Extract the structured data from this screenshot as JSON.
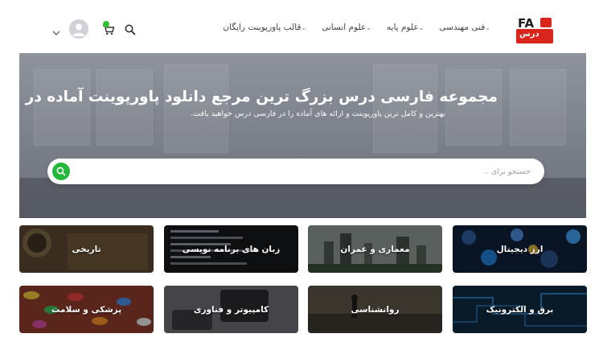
{
  "logo": {
    "latin": "FA",
    "persian": "درس"
  },
  "nav": [
    {
      "label": "فنی مهندسی"
    },
    {
      "label": "علوم پایه"
    },
    {
      "label": "علوم انسانی"
    },
    {
      "label": "قالب پاورپوینت رایگان"
    }
  ],
  "hero": {
    "title": "مجموعه فارسی درس بزرگ ترین مرجع دانلود پاورپوینت آماده در ایران",
    "subtitle": "بهترین و کامل ترین پاورپوینت و ارائه های آماده را در فارسی درس خواهید یافت.",
    "search_placeholder": "جستجو برای .."
  },
  "categories": [
    {
      "label": "ارز دیجیتال",
      "color": "#0f1f3a"
    },
    {
      "label": "معماری و عمران",
      "color": "#6a7468"
    },
    {
      "label": "زبان های برنامه نویسی",
      "color": "#15171b"
    },
    {
      "label": "تاریخی",
      "color": "#4b3a26"
    },
    {
      "label": "برق و الکترونیک",
      "color": "#0e2a40"
    },
    {
      "label": "روانشناسی",
      "color": "#3c3830"
    },
    {
      "label": "کامپیوتر و فناوری",
      "color": "#4a4a4e"
    },
    {
      "label": "پزشکی و سلامت",
      "color": "#8a3a2a"
    }
  ],
  "colors": {
    "accent_green": "#22b83a",
    "logo_red": "#d8261c"
  }
}
